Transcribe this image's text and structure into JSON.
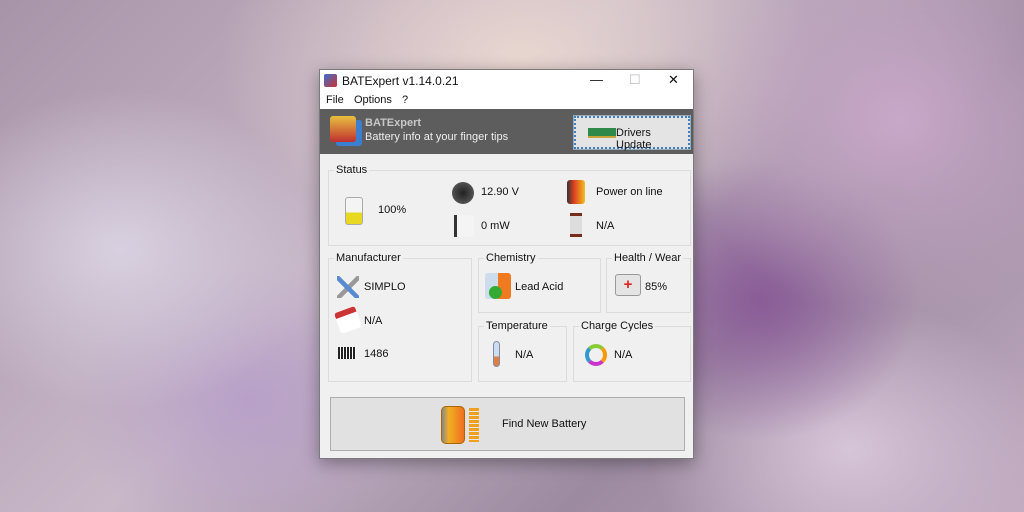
{
  "window": {
    "title": "BATExpert v1.14.0.21",
    "minimize": "—",
    "maximize": "☐",
    "close": "✕"
  },
  "menu": [
    "File",
    "Options",
    "?"
  ],
  "header": {
    "app_name": "BATExpert",
    "tagline": "Battery info at your finger tips",
    "drivers_button": "Drivers Update"
  },
  "status": {
    "label": "Status",
    "charge": "100%",
    "voltage": "12.90 V",
    "rate": "0 mW",
    "power": "Power on line",
    "time": "N/A"
  },
  "manufacturer": {
    "label": "Manufacturer",
    "name": "SIMPLO",
    "date": "N/A",
    "serial": "1486"
  },
  "chemistry": {
    "label": "Chemistry",
    "value": "Lead Acid"
  },
  "health": {
    "label": "Health / Wear",
    "value": "85%"
  },
  "temperature": {
    "label": "Temperature",
    "value": "N/A"
  },
  "cycles": {
    "label": "Charge Cycles",
    "value": "N/A"
  },
  "find_button": "Find New Battery"
}
